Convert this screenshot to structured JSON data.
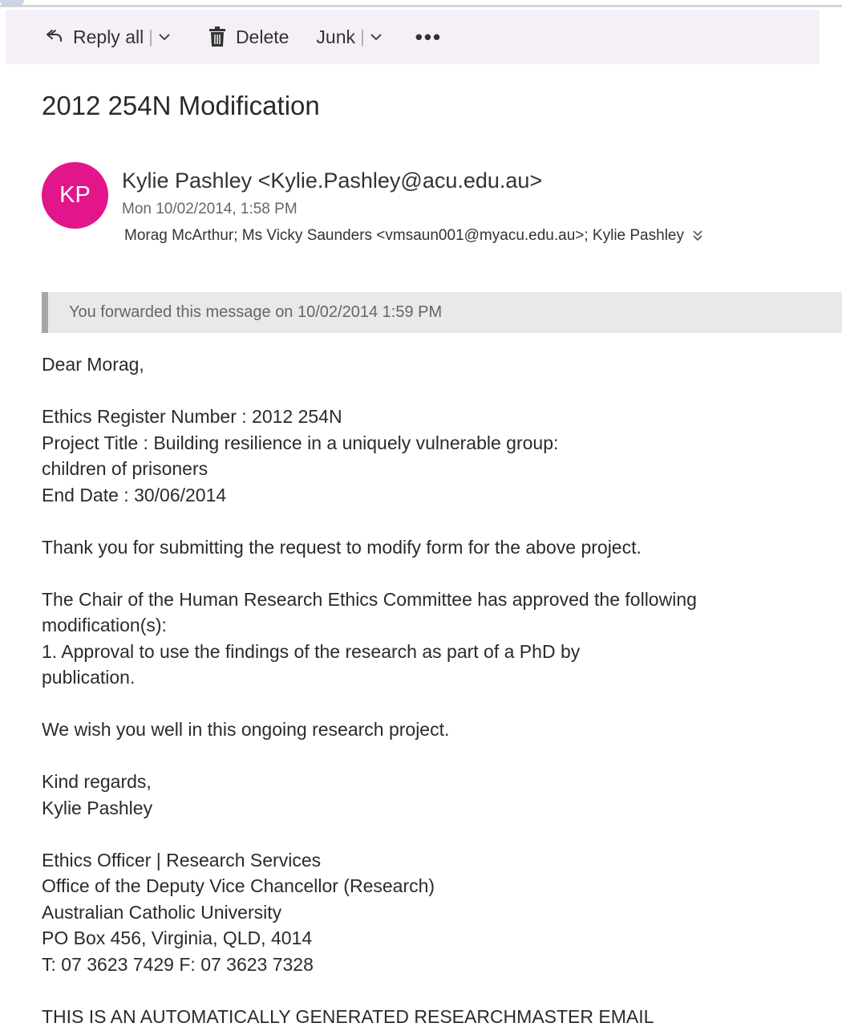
{
  "toolbar": {
    "reply_all": "Reply all",
    "delete": "Delete",
    "junk": "Junk",
    "more": "•••"
  },
  "message": {
    "subject": "2012 254N Modification",
    "avatar_initials": "KP",
    "avatar_color": "#e3158a",
    "from": "Kylie Pashley <Kylie.Pashley@acu.edu.au>",
    "date": "Mon 10/02/2014, 1:58 PM",
    "recipients": "Morag McArthur; Ms Vicky Saunders <vmsaun001@myacu.edu.au>; Kylie Pashley",
    "notice": "You forwarded this message on 10/02/2014 1:59 PM"
  },
  "body": {
    "greeting": "Dear Morag,",
    "register": "Ethics Register Number : 2012 254N",
    "title_line1": "Project Title : Building resilience in a uniquely vulnerable group:",
    "title_line2": "children of prisoners",
    "end_date": "End Date : 30/06/2014",
    "thanks": "Thank you for submitting the request to modify form for the above project.",
    "chair_line1": "The Chair of the Human Research Ethics Committee has approved the following",
    "chair_line2": "modification(s):",
    "item_line1": "1. Approval to use the findings of the research as part of a PhD by",
    "item_line2": "publication.",
    "wish": "We wish you well in this ongoing research project.",
    "regards": "Kind regards,",
    "signature_name": "Kylie Pashley",
    "sig_role": "Ethics Officer | Research Services",
    "sig_office": "Office of the Deputy Vice Chancellor (Research)",
    "sig_uni": "Australian Catholic University",
    "sig_address": "PO Box 456, Virginia, QLD, 4014",
    "sig_phone": "T: 07 3623 7429  F: 07 3623 7328",
    "auto_notice": "THIS IS AN AUTOMATICALLY GENERATED RESEARCHMASTER EMAIL"
  }
}
